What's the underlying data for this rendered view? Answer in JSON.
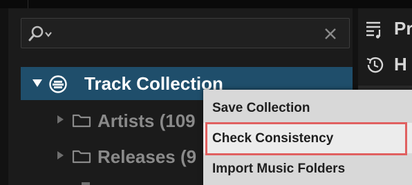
{
  "search": {
    "value": "",
    "placeholder": "",
    "search_icon": "search-icon",
    "dropdown_icon": "chevron-down-icon",
    "clear_icon": "close-icon"
  },
  "tree": {
    "root": {
      "label": "Track Collection",
      "icon": "collection-icon",
      "expanded": true
    },
    "children": [
      {
        "label": "Artists (109",
        "icon": "folder-icon"
      },
      {
        "label": "Releases (9",
        "icon": "folder-icon"
      }
    ]
  },
  "right_panel": {
    "items": [
      {
        "label": "Pr",
        "icon": "playlist-icon"
      },
      {
        "label": "H",
        "icon": "history-icon"
      }
    ]
  },
  "context_menu": {
    "items": [
      {
        "label": "Save Collection"
      },
      {
        "label": "Check Consistency",
        "highlighted": true
      },
      {
        "label": "Import Music Folders"
      }
    ]
  },
  "colors": {
    "selection": "#1f4e6b",
    "highlight_border": "#e06060",
    "menu_bg": "#d8d8d8"
  }
}
